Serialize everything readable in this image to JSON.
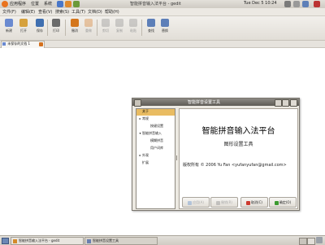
{
  "top_panel": {
    "menus": [
      "应用程序",
      "位置",
      "系统"
    ],
    "window_title": "智能拼音输入法平台 - gedit",
    "datetime": "Tue Dec 5 10:24"
  },
  "menubar": {
    "items": [
      "文件(F)",
      "编辑(E)",
      "查看(V)",
      "搜索(S)",
      "工具(T)",
      "文档(D)",
      "帮助(H)"
    ]
  },
  "toolbar": {
    "buttons": [
      {
        "label": "新建",
        "icon": "new-document-icon",
        "color": "#6a8ad0",
        "enabled": true
      },
      {
        "label": "打开",
        "icon": "open-folder-icon",
        "color": "#d6a13c",
        "enabled": true
      },
      {
        "label": "保存",
        "icon": "save-icon",
        "color": "#3f6fb0",
        "enabled": true
      },
      {
        "label": "打印",
        "icon": "print-icon",
        "color": "#6b6b6b",
        "enabled": true
      },
      {
        "label": "撤消",
        "icon": "undo-icon",
        "color": "#d4761c",
        "enabled": true
      },
      {
        "label": "重做",
        "icon": "redo-icon",
        "color": "#d4761c",
        "enabled": false
      },
      {
        "label": "剪切",
        "icon": "cut-icon",
        "color": "#888888",
        "enabled": false
      },
      {
        "label": "复制",
        "icon": "copy-icon",
        "color": "#888888",
        "enabled": false
      },
      {
        "label": "粘贴",
        "icon": "paste-icon",
        "color": "#888888",
        "enabled": false
      },
      {
        "label": "查找",
        "icon": "find-icon",
        "color": "#5d7fb8",
        "enabled": true
      },
      {
        "label": "替换",
        "icon": "replace-icon",
        "color": "#5d7fb8",
        "enabled": true
      }
    ]
  },
  "tabs": [
    {
      "label": "未保存的文档 1"
    }
  ],
  "dialog": {
    "title": "智能拼音设置工具",
    "tree": [
      {
        "label": "关于",
        "depth": 0,
        "expander": "",
        "selected": true
      },
      {
        "label": "常规",
        "depth": 0,
        "expander": "▸",
        "selected": false
      },
      {
        "label": "按键设置",
        "depth": 1,
        "expander": "",
        "selected": false
      },
      {
        "label": "智能拼音输入",
        "depth": 0,
        "expander": "▾",
        "selected": false
      },
      {
        "label": "模糊拼音",
        "depth": 1,
        "expander": "",
        "selected": false
      },
      {
        "label": "用户词库",
        "depth": 1,
        "expander": "",
        "selected": false
      },
      {
        "label": "外观",
        "depth": 0,
        "expander": "▸",
        "selected": false
      },
      {
        "label": "扩展",
        "depth": 0,
        "expander": "",
        "selected": false
      }
    ],
    "content": {
      "heading": "智能拼音输入法平台",
      "subheading": "图形设置工具",
      "copyright": "版权所有 © 2006 Yu Fan <yufanyufan@gmail.com>"
    },
    "buttons": [
      {
        "label": "应用(A)",
        "icon": "apply-icon",
        "color": "#7b9fd0",
        "enabled": false
      },
      {
        "label": "撤销(R)",
        "icon": "revert-icon",
        "color": "#999999",
        "enabled": false
      },
      {
        "label": "取消(C)",
        "icon": "cancel-icon",
        "color": "#cc3b2f",
        "enabled": true
      },
      {
        "label": "确定(O)",
        "icon": "ok-icon",
        "color": "#3b9a2f",
        "enabled": true
      }
    ]
  },
  "taskbar": {
    "tasks": [
      {
        "label": "智能拼音输入法平台 - gedit",
        "icon": "gedit-icon",
        "color": "#d48a2a"
      },
      {
        "label": "智能拼音设置工具",
        "icon": "settings-icon",
        "color": "#6a7fb0"
      }
    ]
  }
}
